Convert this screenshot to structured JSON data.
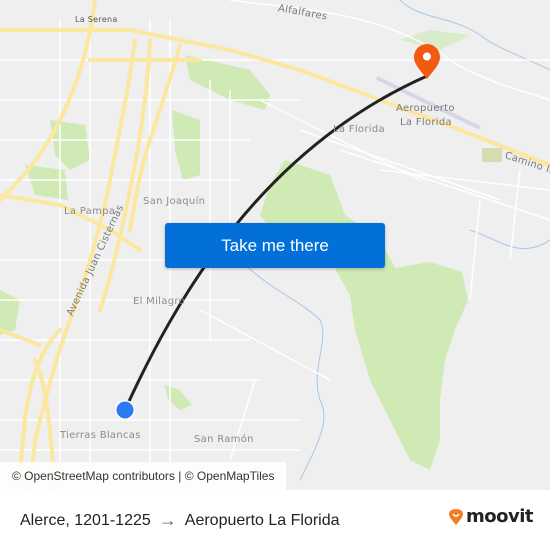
{
  "map": {
    "places": {
      "la_serena": "La Serena",
      "alfalfares": "Alfalfares",
      "aeropuerto_line1": "Aeropuerto",
      "aeropuerto_line2": "La Florida",
      "la_florida": "La Florida",
      "camino": "Camino In",
      "san_joaquin": "San Joaquín",
      "la_pampa": "La Pampa",
      "avenida": "Avenida Juan Cisternas",
      "el_milagro": "El Milagro",
      "tierras_blancas": "Tierras Blancas",
      "san_ramon": "San Ramón"
    },
    "origin_marker": {
      "icon": "origin-dot-icon",
      "color": "#2a7bf2"
    },
    "destination_marker": {
      "icon": "map-pin-icon",
      "color": "#f25a12"
    },
    "route_line_color": "#222222",
    "cta_label": "Take me there",
    "cta_color": "#0270d8",
    "attribution": "© OpenStreetMap contributors | © OpenMapTiles"
  },
  "footer": {
    "origin": "Alerce, 1201-1225",
    "arrow": "→",
    "destination": "Aeropuerto La Florida",
    "logo_text": "moovit",
    "logo_color": "#f57c1f"
  }
}
